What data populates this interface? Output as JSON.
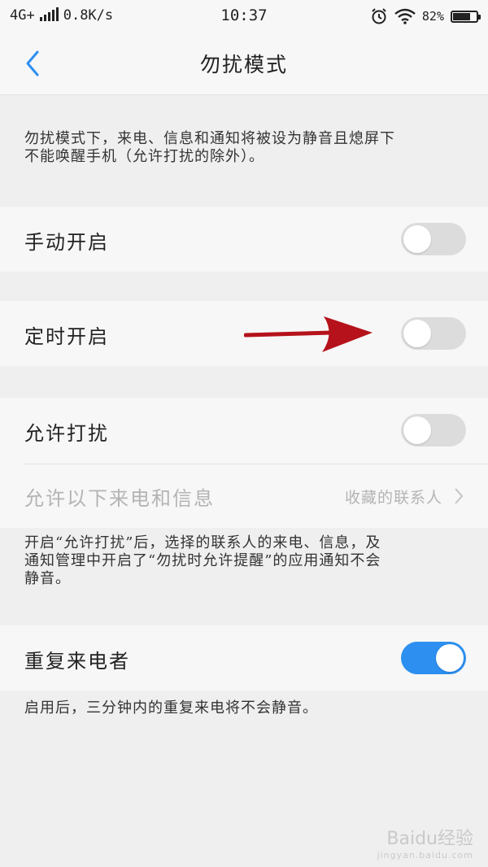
{
  "status_bar": {
    "network": "4G+",
    "speed": "0.8K/s",
    "time": "10:37",
    "battery": "82%",
    "battery_level": 0.82,
    "icons": [
      "signal-icon",
      "alarm-icon",
      "wifi-icon",
      "battery-icon"
    ]
  },
  "header": {
    "title": "勿扰模式",
    "back_icon": "chevron-left-icon"
  },
  "intro": {
    "line1": "勿扰模式下，来电、信息和通知将被设为静音且熄屏下",
    "line2": "不能唤醒手机（允许打扰的除外）。"
  },
  "settings": {
    "manual": {
      "label": "手动开启",
      "enabled": false
    },
    "scheduled": {
      "label": "定时开启",
      "enabled": false
    },
    "allow": {
      "label": "允许打扰",
      "enabled": false
    },
    "allow_from": {
      "label": "允许以下来电和信息",
      "value": "收藏的联系人"
    },
    "allow_desc": {
      "line1": "开启“允许打扰”后，选择的联系人的来电、信息，及",
      "line2": "通知管理中开启了“勿扰时允许提醒”的应用通知不会",
      "line3": "静音。"
    },
    "repeat": {
      "label": "重复来电者",
      "enabled": true
    },
    "repeat_desc": "启用后，三分钟内的重复来电将不会静音。"
  },
  "colors": {
    "accent": "#2d8ff0",
    "back_arrow": "#2d8ff0",
    "annotation_arrow": "#b5121b"
  },
  "watermark": {
    "brand": "Baidu经验",
    "url": "jingyan.baidu.com"
  }
}
